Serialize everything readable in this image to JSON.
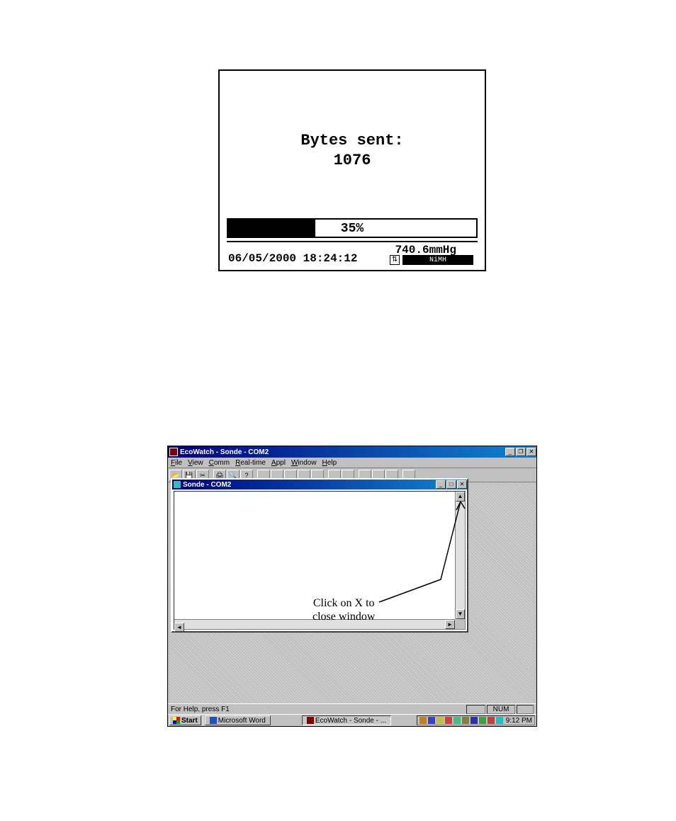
{
  "device": {
    "message_label": "Bytes sent:",
    "bytes_sent": "1076",
    "progress_percent": "35%",
    "progress_fill_pct": 35,
    "datetime": "06/05/2000 18:24:12",
    "pressure": "740.6mmHg",
    "battery_type": "NiMH"
  },
  "app": {
    "title": "EcoWatch - Sonde - COM2",
    "menus": {
      "file": "File",
      "view": "View",
      "comm": "Comm",
      "realtime": "Real-time",
      "appl": "Appl",
      "window": "Window",
      "help": "Help"
    },
    "statusbar_left": "For Help, press F1",
    "statusbar_num": "NUM"
  },
  "child_window": {
    "title": "Sonde - COM2"
  },
  "annotation": {
    "line1": "Click on X to",
    "line2": "close window"
  },
  "taskbar": {
    "start": "Start",
    "task_word": "Microsoft Word",
    "task_active": "EcoWatch - Sonde - ...",
    "clock": "9:12 PM"
  }
}
